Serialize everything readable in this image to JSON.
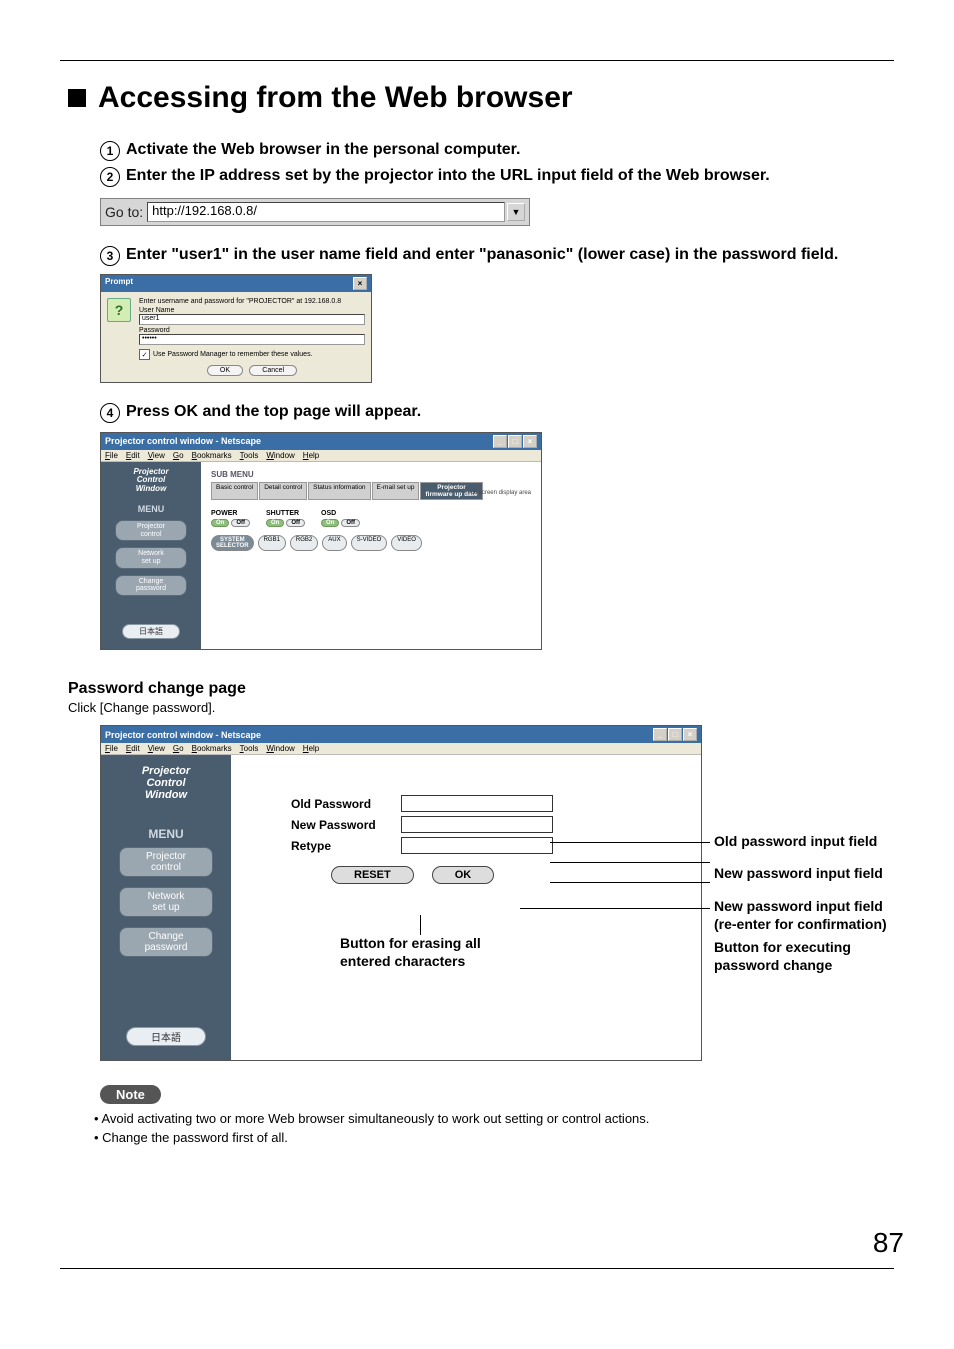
{
  "heading": "Accessing from the Web browser",
  "steps": {
    "s1": "Activate the Web browser in the personal computer.",
    "s2": "Enter the IP address set by the projector into the URL input field of the Web browser.",
    "s3": "Enter \"user1\" in the user name field and enter \"panasonic\" (lower case) in the password field.",
    "s4": "Press OK and the top page will appear."
  },
  "url_bar": {
    "go_to": "Go to:",
    "url": "http://192.168.0.8/"
  },
  "prompt": {
    "title": "Prompt",
    "message": "Enter username and password for \"PROJECTOR\" at 192.168.0.8",
    "user_label": "User Name",
    "user_value": "user1",
    "pass_label": "Password",
    "pass_value": "••••••",
    "remember": "Use Password Manager to remember these values.",
    "ok": "OK",
    "cancel": "Cancel"
  },
  "pcw": {
    "title": "Projector control window - Netscape",
    "menus": [
      "File",
      "Edit",
      "View",
      "Go",
      "Bookmarks",
      "Tools",
      "Window",
      "Help"
    ],
    "logo_lines": [
      "Projector",
      "Control",
      "Window"
    ],
    "menu_label": "MENU",
    "side_items": {
      "projector_control": "Projector\ncontrol",
      "network_setup": "Network\nset up",
      "change_password": "Change\npassword"
    },
    "lang": "日本語",
    "submenu": "SUB MENU",
    "tabs": [
      "Basic control",
      "Detail control",
      "Status information",
      "E-mail set up"
    ],
    "tab_fw": "Projector\nfirmware up date",
    "power": "POWER",
    "shutter": "SHUTTER",
    "osd": "OSD",
    "on": "On",
    "off": "Off",
    "disp_area": "on screen display area",
    "src": {
      "sys": "SYSTEM\nSELECTOR",
      "rgb1": "RGB1",
      "rgb2": "RGB2",
      "aux": "AUX",
      "svideo": "S-VIDEO",
      "video": "VIDEO"
    }
  },
  "pwpage": {
    "heading": "Password change page",
    "instruction": "Click [Change password].",
    "old": "Old Password",
    "new": "New Password",
    "retype": "Retype",
    "reset": "RESET",
    "ok": "OK"
  },
  "callouts": {
    "erase": "Button for erasing all\nentered characters",
    "old_field": "Old password input field",
    "new_field": "New password input field",
    "conf_field_l1": "New password input field",
    "conf_field_l2": "(re-enter for confirmation)",
    "exec_l1": "Button for executing",
    "exec_l2": "password change"
  },
  "note": {
    "label": "Note",
    "items": [
      "Avoid activating two or more Web browser simultaneously to work out setting or control actions.",
      "Change the password first of all."
    ]
  },
  "page_number": "87"
}
